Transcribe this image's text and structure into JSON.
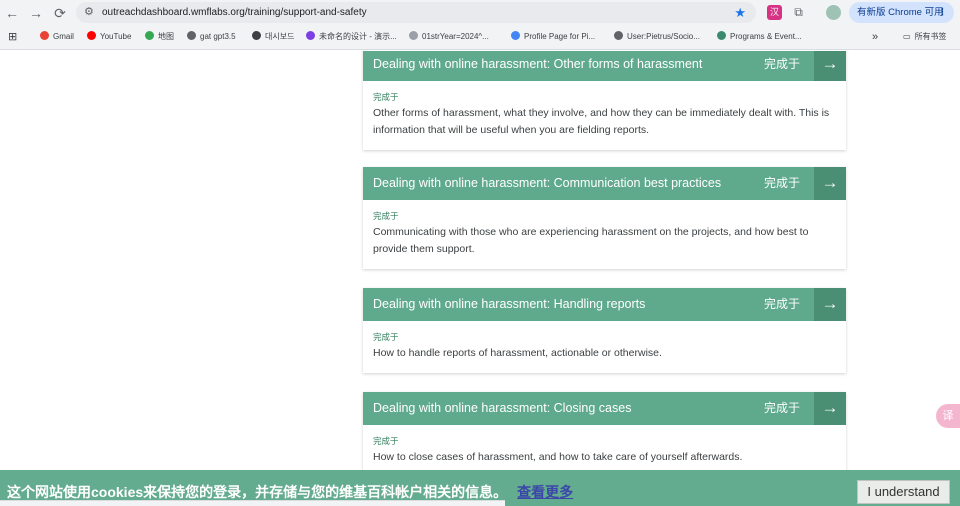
{
  "browser": {
    "url": "outreachdashboard.wmflabs.org/training/support-and-safety",
    "update_button": "有新版 Chrome 可用",
    "nav_back": "←",
    "nav_forward": "→",
    "nav_reload": "⟳",
    "site_info_icon": "⚙",
    "star_icon": "★",
    "update_dots": "⋮",
    "ext_icon_label": "汉",
    "puzzle_icon": "⧉",
    "apps_icon": "⊞",
    "more_bookmarks": "»",
    "folder_icon": "▭",
    "bookmarks": [
      {
        "label": "Gmail",
        "color": "#ea4335"
      },
      {
        "label": "YouTube",
        "color": "#ff0000"
      },
      {
        "label": "地图",
        "color": "#34a853"
      },
      {
        "label": "gat gpt3.5",
        "color": "#5f6368"
      },
      {
        "label": "대시보드",
        "color": "#3c4043"
      },
      {
        "label": "未命名的设计 - 演示...",
        "color": "#7b3fe4"
      },
      {
        "label": "01strYear=2024^...",
        "color": "#9aa0a6"
      },
      {
        "label": "Profile Page for Pi...",
        "color": "#4285f4"
      },
      {
        "label": "User:Pietrus/Socio...",
        "color": "#5f6368"
      },
      {
        "label": "Programs & Event...",
        "color": "#3c8a6e"
      }
    ],
    "all_bookmarks": "所有书签"
  },
  "modules": [
    {
      "title": "Dealing with online harassment: Other forms of harassment",
      "status": "完成于",
      "done_label": "完成于",
      "description": "Other forms of harassment, what they involve, and how they can be immediately dealt with. This is information that will be useful when you are fielding reports."
    },
    {
      "title": "Dealing with online harassment: Communication best practices",
      "status": "完成于",
      "done_label": "完成于",
      "description": "Communicating with those who are experiencing harassment on the projects, and how best to provide them support."
    },
    {
      "title": "Dealing with online harassment: Handling reports",
      "status": "完成于",
      "done_label": "完成于",
      "description": "How to handle reports of harassment, actionable or otherwise."
    },
    {
      "title": "Dealing with online harassment: Closing cases",
      "status": "完成于",
      "done_label": "完成于",
      "description": "How to close cases of harassment, and how to take care of yourself afterwards."
    }
  ],
  "arrow_icon": "→",
  "cookie_banner": {
    "message": "这个网站使用cookies来保持您的登录，并存储与您的维基百科帐户相关的信息。",
    "link": "查看更多",
    "button": "I understand"
  },
  "translate_icon": "译",
  "colors": {
    "header_green": "#5fa98c",
    "arrow_green": "#4a8f74",
    "banner_green": "#64ac8f"
  }
}
